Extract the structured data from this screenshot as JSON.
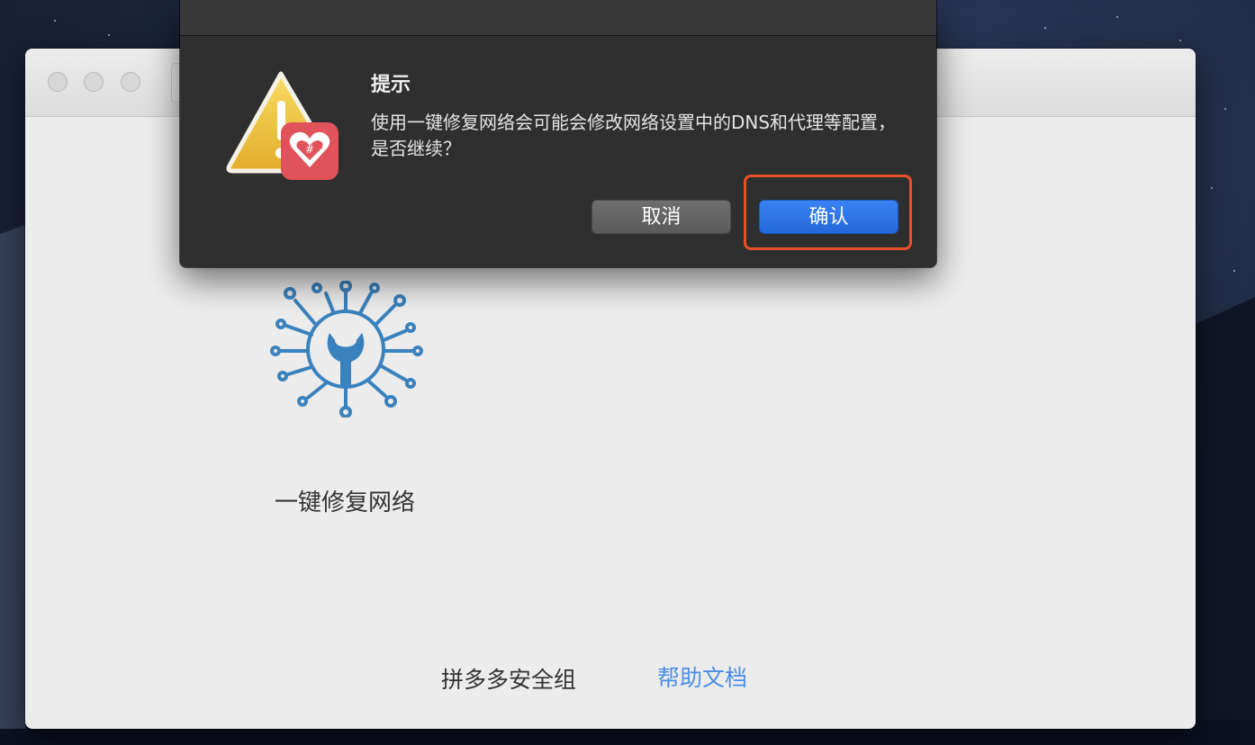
{
  "window": {
    "main_label": "一键修复网络",
    "footer_team": "拼多多安全组",
    "footer_help": "帮助文档"
  },
  "dialog": {
    "title": "提示",
    "message": "使用一键修复网络会可能会修改网络设置中的DNS和代理等配置，是否继续？",
    "cancel_label": "取消",
    "confirm_label": "确认"
  },
  "colors": {
    "accent": "#2a70e4",
    "highlight": "#e8502a",
    "link": "#4c8ee8",
    "icon_blue": "#3a82bd"
  },
  "icons": [
    "warning-icon",
    "pinduoduo-logo-icon",
    "network-repair-icon"
  ]
}
